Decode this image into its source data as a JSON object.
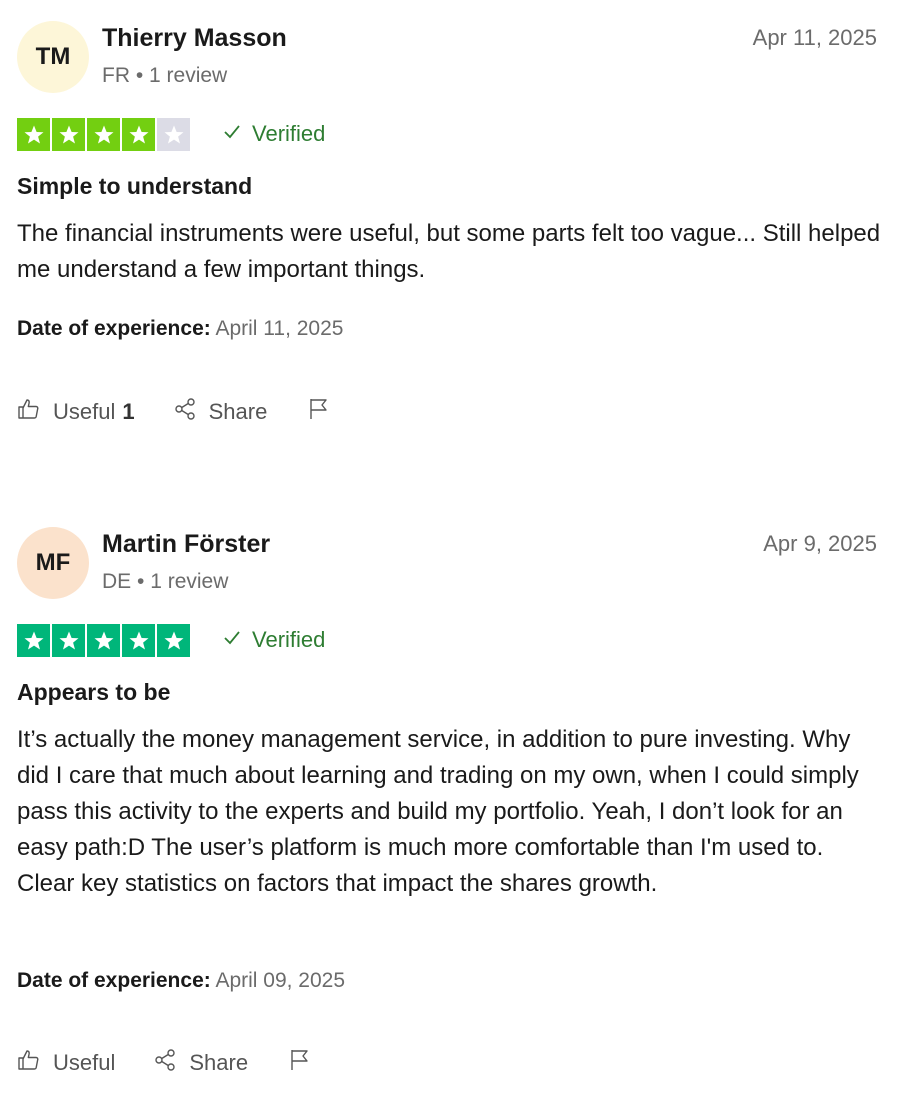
{
  "reviews": [
    {
      "initials": "TM",
      "avatar_color": "#fdf6d8",
      "name": "Thierry Masson",
      "meta": "FR • 1 review",
      "date": "Apr 11, 2025",
      "rating": 4,
      "star_color": "#73cf11",
      "verified_label": "Verified",
      "title": "Simple to understand",
      "body": "The financial instruments were useful, but some parts felt too vague... Still helped me understand a few important things.",
      "experience_label": "Date of experience:",
      "experience_date": "April 11, 2025",
      "useful_label": "Useful",
      "useful_count": "1",
      "share_label": "Share"
    },
    {
      "initials": "MF",
      "avatar_color": "#fbe2cc",
      "name": "Martin Förster",
      "meta": "DE • 1 review",
      "date": "Apr 9, 2025",
      "rating": 5,
      "star_color": "#00b67a",
      "verified_label": "Verified",
      "title": "Appears to be",
      "body": "It’s actually the money management service, in addition to pure investing. Why did I care that much about learning and trading on my own, when I could simply pass this activity to the experts and build my portfolio. Yeah, I don’t look for an easy path:D The user’s platform is much more comfortable than I'm used to. Clear key statistics on factors that impact the shares growth.",
      "experience_label": "Date of experience:",
      "experience_date": "April 09, 2025",
      "useful_label": "Useful",
      "useful_count": "",
      "share_label": "Share"
    }
  ],
  "colors": {
    "empty_star": "#dcdce6",
    "verified": "#2e7d32"
  },
  "icons": [
    "thumbs-up-icon",
    "share-icon",
    "flag-icon",
    "checkmark-icon",
    "star-icon"
  ]
}
